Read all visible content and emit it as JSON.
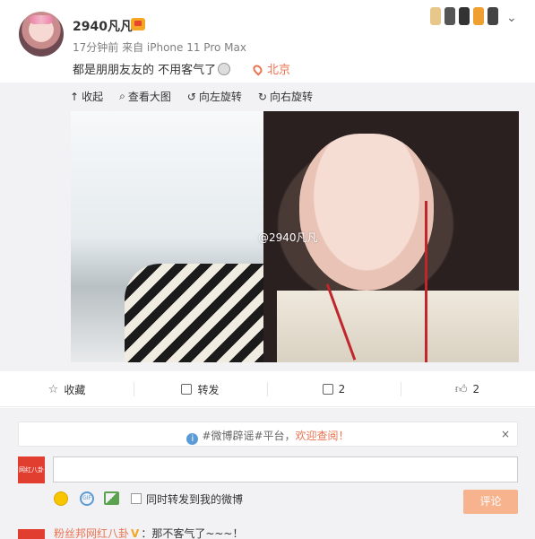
{
  "header": {
    "username": "2940凡凡",
    "meta": "17分钟前 来自 iPhone 11 Pro Max",
    "text": "都是朋朋友友的 不用客气了",
    "location": "北京"
  },
  "image_toolbar": {
    "collapse": "收起",
    "view_large": "查看大图",
    "rotate_left": "向左旋转",
    "rotate_right": "向右旋转",
    "collapse_icon": "up-arrow-icon",
    "view_icon": "magnifier-icon",
    "rotate_left_icon": "rotate-left-icon",
    "rotate_right_icon": "rotate-right-icon"
  },
  "photo": {
    "watermark": "@2940凡凡"
  },
  "actions": {
    "favorite": "收藏",
    "repost": "转发",
    "comment_count": "2",
    "like_count": "2"
  },
  "notice": {
    "prefix": "#微博辟谣#平台，",
    "link": "欢迎查阅！",
    "close": "×"
  },
  "composer": {
    "avatar_text": "网红八卦",
    "input_value": "",
    "checkbox_label": "同时转发到我的微博",
    "submit": "评论",
    "gif": "GIF"
  },
  "reply": {
    "user": "粉丝邦网红八卦",
    "badge": "V",
    "text": "：那不客气了~~~！"
  },
  "colors": {
    "accent": "#eb7350",
    "submit_bg": "#f6b38e",
    "background": "#f2f2f5"
  }
}
